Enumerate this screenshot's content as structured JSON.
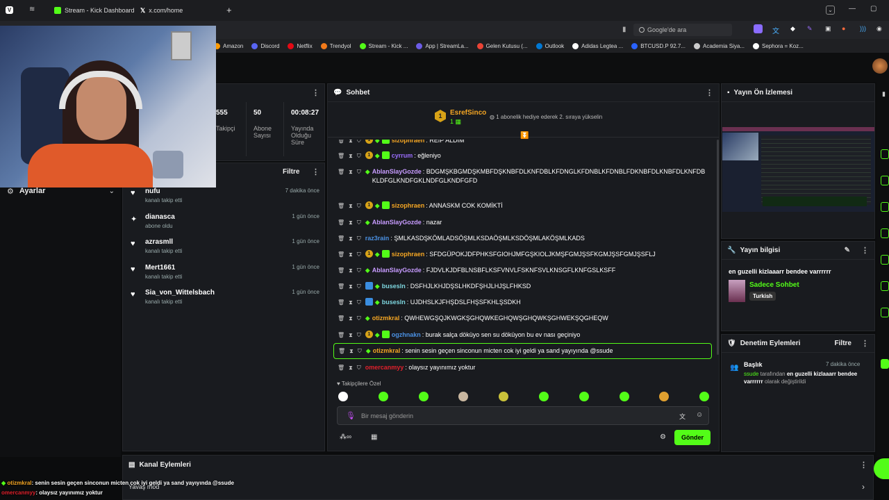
{
  "browser": {
    "tabs": [
      {
        "label": "Stream - Kick Dashboard",
        "color": "#53fc18"
      },
      {
        "label": "x.com/home",
        "color": "#000000"
      }
    ],
    "new_tab": "+",
    "search_placeholder": "Google'de ara",
    "bookmarks": [
      {
        "label": "Amazon",
        "color": "#ff9900"
      },
      {
        "label": "Discord",
        "color": "#5865f2"
      },
      {
        "label": "Netflix",
        "color": "#e50914"
      },
      {
        "label": "Trendyol",
        "color": "#f27a1a"
      },
      {
        "label": "Stream - Kick ...",
        "color": "#53fc18"
      },
      {
        "label": "App | StreamLa...",
        "color": "#6c5ce7"
      },
      {
        "label": "Gelen Kutusu (...",
        "color": "#ea4335"
      },
      {
        "label": "Outlook",
        "color": "#0078d4"
      },
      {
        "label": "Adidas Legtea ...",
        "color": "#ffffff"
      },
      {
        "label": "BTCUSD.P 92.7...",
        "color": "#2962ff"
      },
      {
        "label": "Academia Siya...",
        "color": "#cccccc"
      },
      {
        "label": "Sephora = Koz...",
        "color": "#ffffff"
      }
    ]
  },
  "left": {
    "settings_label": "Ayarlar",
    "stats": [
      {
        "value": "555",
        "label": "Takipçi"
      },
      {
        "value": "50",
        "label": "Abone Sayısı"
      },
      {
        "value": "00:08:27",
        "label": "Yayında Olduğu Süre"
      }
    ],
    "filter_label": "Filtre",
    "activity": [
      {
        "name": "nufu",
        "sub": "kanalı takip etti",
        "time": "7 dakika önce",
        "icon": "heart"
      },
      {
        "name": "dianasca",
        "sub": "abone oldu",
        "time": "1 gün önce",
        "icon": "star"
      },
      {
        "name": "azrasmll",
        "sub": "kanalı takip etti",
        "time": "1 gün önce",
        "icon": "heart"
      },
      {
        "name": "Mert1661",
        "sub": "kanalı takip etti",
        "time": "1 gün önce",
        "icon": "heart"
      },
      {
        "name": "Sia_von_Wittelsbach",
        "sub": "kanalı takip etti",
        "time": "1 gün önce",
        "icon": "heart"
      }
    ]
  },
  "chat": {
    "title": "Sohbet",
    "pinned_user": "EsrefSinco",
    "pinned_count": "1",
    "pinned_text": "1 abonelik hediye ederek 2. sıraya yükselin",
    "messages": [
      {
        "user": "sizophraen",
        "color": "#f5a623",
        "text": "REIP ALDIM",
        "badges": "sub"
      },
      {
        "user": "cyrrum",
        "color": "#9b6dff",
        "text": "eğleniyo",
        "badges": "sub"
      },
      {
        "user": "AblanSlayGozde",
        "color": "#c79bff",
        "text": "BDGMŞKBGMDŞKMBFDŞKNBFDLKNFDBLKFDNGLKFDNBLKFDNBLFDKNBFDLKNBFDLKNFDBKLDFGLKNDFGKLNDFGLKNDFGFD",
        "badges": "gem"
      },
      {
        "user": "sizophraen",
        "color": "#f5a623",
        "text": "ANNASKM COK KOMİKTİ",
        "badges": "sub"
      },
      {
        "user": "AblanSlayGozde",
        "color": "#c79bff",
        "text": "nazar",
        "badges": "gem"
      },
      {
        "user": "raz3rain",
        "color": "#4a90e2",
        "text": "ŞMLKASDŞKÖMLADSÖŞMLKSDAÖŞMLKSDÖŞMLAKÖŞMLKADS",
        "badges": "none"
      },
      {
        "user": "sizophraen",
        "color": "#f5a623",
        "text": "SFDGÜPOKJDFPHKSFGIOHJMFGŞKIOLJKMŞFGMJŞSFKGMJŞSFGMJŞSFLJ",
        "badges": "sub"
      },
      {
        "user": "AblanSlayGozde",
        "color": "#c79bff",
        "text": "FJDVLKJDFBLNSBFLKSFVNVLFSKNFSVLKNSGFLKNFGSLKSFF",
        "badges": "gem"
      },
      {
        "user": "busesln",
        "color": "#7ed6df",
        "text": "DSFHJLKHJDŞSLHKDFŞHJLHJŞLFHKSD",
        "badges": "blue"
      },
      {
        "user": "busesln",
        "color": "#7ed6df",
        "text": "UJDHSLKJFHŞDSLFHŞSFKHLŞSDKH",
        "badges": "blue"
      },
      {
        "user": "otizmkral",
        "color": "#f5a623",
        "text": "QWHEWGŞQJKWGKŞGHQWKEGHQWŞGHQWKŞGHWEKŞQGHEQW",
        "badges": "gem"
      },
      {
        "user": "ogzhnakn",
        "color": "#4a90e2",
        "text": "burak salça döküyo sen su döküyon bu ev nası geçiniyo",
        "badges": "sub"
      },
      {
        "user": "otizmkral",
        "color": "#f5a623",
        "text": "senin sesin geçen sinconun micten cok iyi geldi ya sand yayıyında @ssude",
        "badges": "gem",
        "highlight": true
      },
      {
        "user": "omercanmyy",
        "color": "#e0202b",
        "text": "olaysız yayınımız yoktur",
        "badges": "none"
      }
    ],
    "emote_section": "Takipçilere Özel",
    "emote_colors": [
      "#ffffff",
      "#53fc18",
      "#53fc18",
      "#c9b7a0",
      "#c9c23a",
      "#53fc18",
      "#53fc18",
      "#53fc18",
      "#e0a030",
      "#53fc18"
    ],
    "input_placeholder": "Bir mesaj gönderin",
    "send_label": "Gönder"
  },
  "preview": {
    "title": "Yayın Ön İzlemesi"
  },
  "stream_info": {
    "title": "Yayın bilgisi",
    "stream_title": "en guzelli kizlaaarr bendee varrrrrr",
    "category": "Sadece Sohbet",
    "language": "Turkish"
  },
  "mod_actions": {
    "title": "Denetim Eylemleri",
    "filter_label": "Filtre",
    "entry_title": "Başlık",
    "entry_time": "7 dakika önce",
    "entry_user": "ssude",
    "entry_mid": "tarafından",
    "entry_value": "en guzelli kizlaaarr bendee varrrrrr",
    "entry_end": "olarak değiştirildi"
  },
  "channel_actions": {
    "title": "Kanal Eylemleri",
    "partial": "Yavaş mod"
  },
  "overlay": {
    "line1_user": "otizmkral",
    "line1_text": ": senin sesin geçen sinconun micten cok iyi geldi ya sand yayıyında @ssude",
    "line2_user": "omercanmyy",
    "line2_text": ": olaysız yayınımız yoktur"
  }
}
